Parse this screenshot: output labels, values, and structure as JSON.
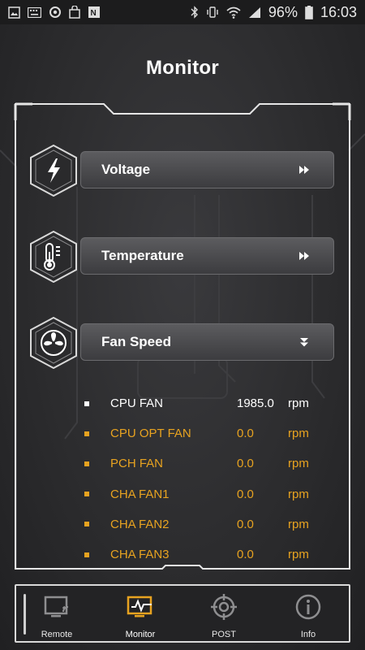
{
  "status_bar": {
    "battery": "96%",
    "time": "16:03",
    "left_icons": [
      "image-icon",
      "keyboard-icon",
      "sync-icon",
      "shopping-bag-icon",
      "onenote-icon"
    ],
    "right_icons": [
      "bluetooth-icon",
      "vibrate-icon",
      "wifi-icon",
      "signal-icon",
      "battery-icon"
    ]
  },
  "page": {
    "title": "Monitor"
  },
  "menu": [
    {
      "label": "Voltage",
      "icon": "lightning-icon",
      "arrow": "double-chevron-right-icon"
    },
    {
      "label": "Temperature",
      "icon": "thermometer-icon",
      "arrow": "double-chevron-right-icon"
    },
    {
      "label": "Fan Speed",
      "icon": "fan-icon",
      "arrow": "double-chevron-down-icon"
    }
  ],
  "fans": [
    {
      "name": "CPU FAN",
      "value": "1985.0",
      "unit": "rpm",
      "status": "active"
    },
    {
      "name": "CPU OPT FAN",
      "value": "0.0",
      "unit": "rpm",
      "status": "inactive"
    },
    {
      "name": "PCH FAN",
      "value": "0.0",
      "unit": "rpm",
      "status": "inactive"
    },
    {
      "name": "CHA FAN1",
      "value": "0.0",
      "unit": "rpm",
      "status": "inactive"
    },
    {
      "name": "CHA FAN2",
      "value": "0.0",
      "unit": "rpm",
      "status": "inactive"
    },
    {
      "name": "CHA FAN3",
      "value": "0.0",
      "unit": "rpm",
      "status": "inactive"
    }
  ],
  "tabs": [
    {
      "label": "Remote",
      "icon": "remote-display-icon",
      "active": false
    },
    {
      "label": "Monitor",
      "icon": "monitor-pulse-icon",
      "active": true
    },
    {
      "label": "POST",
      "icon": "crosshair-icon",
      "active": false
    },
    {
      "label": "Info",
      "icon": "info-icon",
      "active": false
    }
  ],
  "colors": {
    "accent": "#e8a320",
    "active_text": "#ffffff",
    "inactive_text": "#e8a320",
    "frame": "#e6e6e6",
    "background": "#2f2f31"
  }
}
